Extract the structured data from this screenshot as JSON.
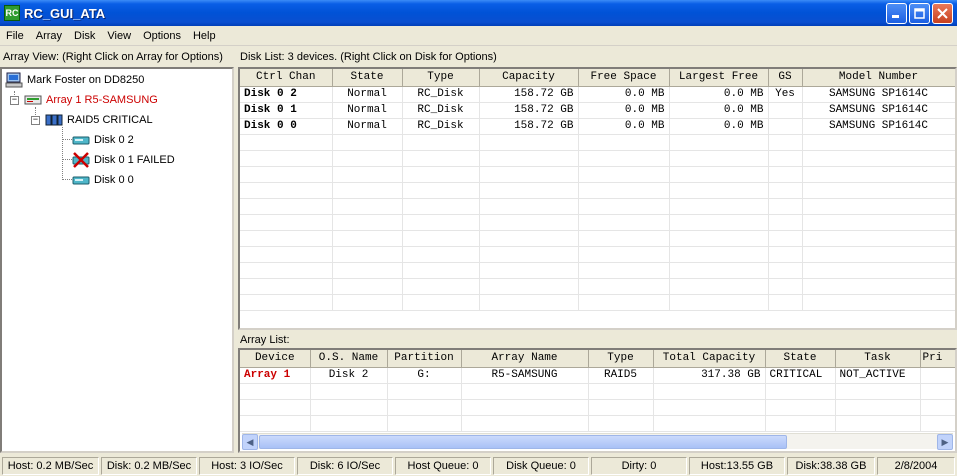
{
  "window": {
    "title": "RC_GUI_ATA",
    "icon_label": "RC",
    "icon": "app-icon"
  },
  "menu": [
    "File",
    "Array",
    "Disk",
    "View",
    "Options",
    "Help"
  ],
  "array_view": {
    "header": "Array View:  (Right Click on Array for Options)",
    "tree": {
      "host": "Mark Foster on DD8250",
      "array": "Array 1  R5-SAMSUNG",
      "raid": "RAID5 CRITICAL",
      "disks": [
        "Disk  0 2",
        "Disk  0 1  FAILED",
        "Disk  0 0"
      ]
    }
  },
  "disk_list": {
    "header": "Disk List: 3 devices.  (Right Click on Disk for Options)",
    "columns": [
      "Ctrl Chan",
      "State",
      "Type",
      "Capacity",
      "Free Space",
      "Largest Free",
      "GS",
      "Model Number"
    ],
    "rows": [
      [
        "Disk  0 2",
        "Normal",
        "RC_Disk",
        "158.72 GB",
        "0.0 MB",
        "0.0 MB",
        "Yes",
        "SAMSUNG SP1614C"
      ],
      [
        "Disk  0 1",
        "Normal",
        "RC_Disk",
        "158.72 GB",
        "0.0 MB",
        "0.0 MB",
        "",
        "SAMSUNG SP1614C"
      ],
      [
        "Disk  0 0",
        "Normal",
        "RC_Disk",
        "158.72 GB",
        "0.0 MB",
        "0.0 MB",
        "",
        "SAMSUNG SP1614C"
      ]
    ]
  },
  "array_list": {
    "header": "Array List:",
    "columns": [
      "Device",
      "O.S. Name",
      "Partition",
      "Array Name",
      "Type",
      "Total Capacity",
      "State",
      "Task",
      "Pri"
    ],
    "rows": [
      [
        "Array 1",
        "Disk 2",
        "G:",
        "R5-SAMSUNG",
        "RAID5",
        "317.38 GB",
        "CRITICAL",
        "NOT_ACTIVE",
        ""
      ]
    ],
    "scroll_position": 0
  },
  "status": [
    "Host: 0.2 MB/Sec",
    "Disk: 0.2 MB/Sec",
    "Host: 3 IO/Sec",
    "Disk: 6 IO/Sec",
    "Host Queue: 0",
    "Disk Queue: 0",
    "Dirty: 0",
    "Host:13.55 GB",
    "Disk:38.38 GB",
    "2/8/2004"
  ],
  "colors": {
    "array_red": "#cc0000",
    "failed_red": "#cc0000",
    "selection": "#316ac5"
  }
}
